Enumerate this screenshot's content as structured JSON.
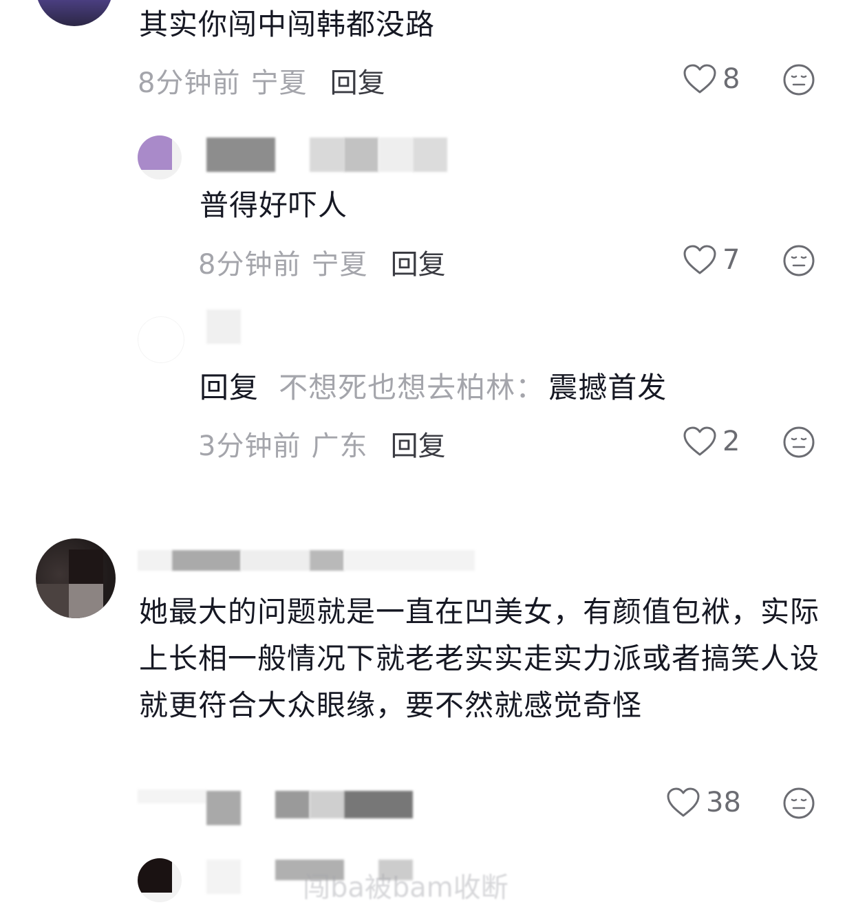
{
  "comments": [
    {
      "text": "其实你闯中闯韩都没路",
      "time": "8分钟前",
      "location": "宁夏",
      "reply_label": "回复",
      "likes": "8"
    },
    {
      "text": "普得好吓人",
      "time": "8分钟前",
      "location": "宁夏",
      "reply_label": "回复",
      "likes": "7"
    },
    {
      "reply_prefix": "回复",
      "reply_to": "不想死也想去柏林",
      "separator": "：",
      "text": "震撼首发",
      "time": "3分钟前",
      "location": "广东",
      "reply_label": "回复",
      "likes": "2"
    },
    {
      "text": "她最大的问题就是一直在凹美女，有颜值包袱，实际上长相一般情况下就老老实实走实力派或者搞笑人设就更符合大众眼缘，要不然就感觉奇怪",
      "likes": "38"
    },
    {
      "username_partial": "闯ba被bam收断"
    }
  ],
  "icons": {
    "like": "heart-outline-icon",
    "dislike": "meh-face-icon"
  },
  "colors": {
    "text": "#161823",
    "meta": "#a4a5ab",
    "reply": "#3a3b42",
    "icon": "#6b6c72"
  }
}
